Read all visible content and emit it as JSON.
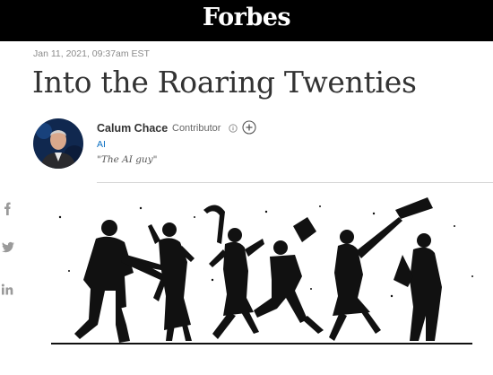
{
  "brand": {
    "logo_text": "Forbes"
  },
  "article": {
    "dateline": "Jan 11, 2021, 09:37am EST",
    "title": "Into the Roaring Twenties"
  },
  "author": {
    "name": "Calum Chace",
    "role": "Contributor",
    "tag": "AI",
    "bio": "\"The AI guy\""
  },
  "share": {
    "icons": [
      "facebook-icon",
      "twitter-icon",
      "linkedin-icon"
    ]
  },
  "hero_image": {
    "subject": "black silhouettes of roaring twenties jazz band musicians and flapper dancers"
  }
}
